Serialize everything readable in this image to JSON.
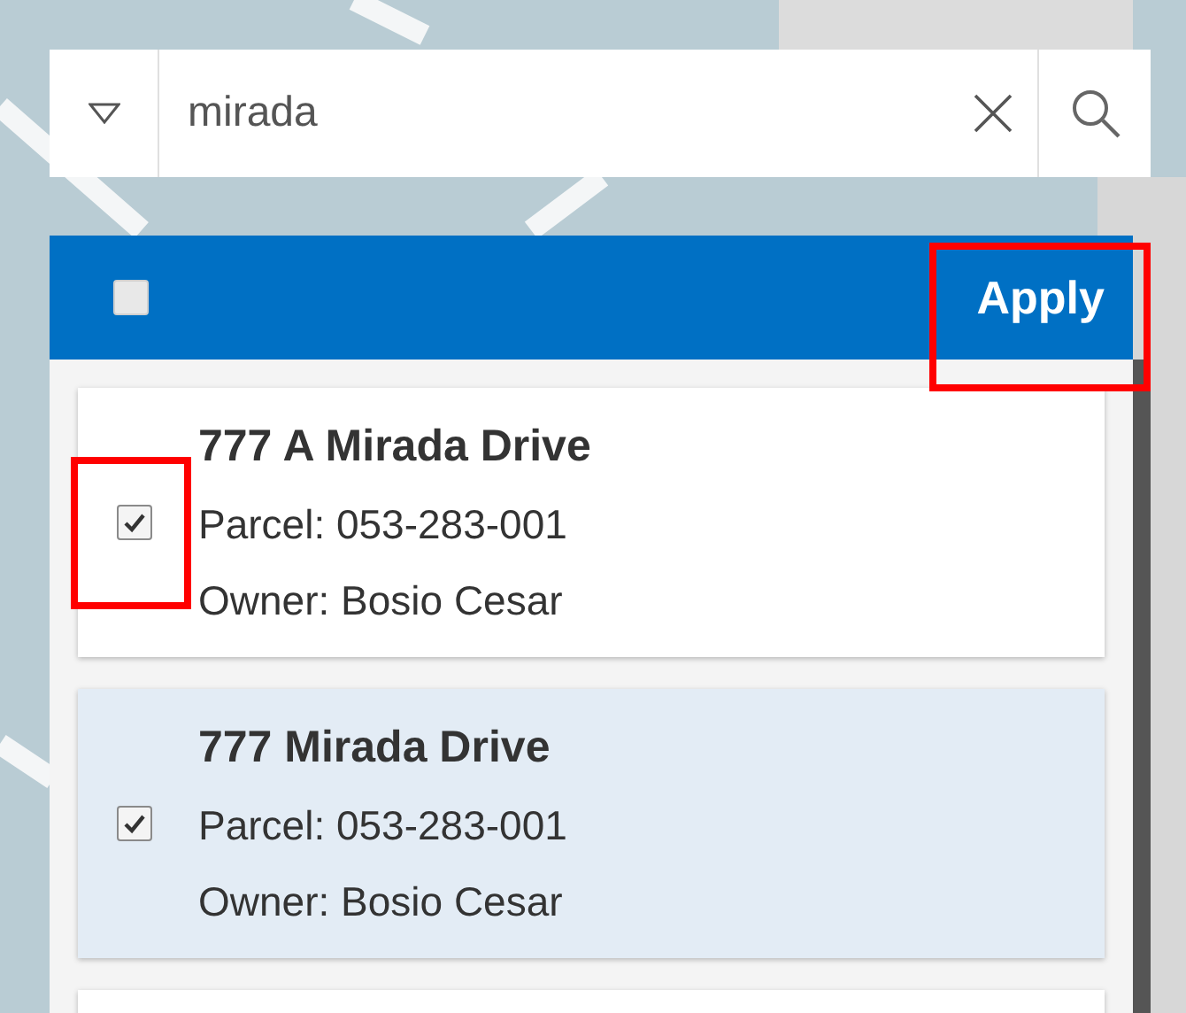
{
  "search": {
    "value": "mirada"
  },
  "header": {
    "select_all_checked": false,
    "apply_button": {
      "label": "Apply",
      "highlighted": true
    }
  },
  "results": [
    {
      "address": "777 A Mirada Drive",
      "parcel": "Parcel: 053-283-001",
      "owner": "Owner: Bosio Cesar",
      "checked": true,
      "selected": false,
      "checkbox_highlighted": true
    },
    {
      "address": "777 Mirada Drive",
      "parcel": "Parcel: 053-283-001",
      "owner": "Owner: Bosio Cesar",
      "checked": true,
      "selected": true,
      "checkbox_highlighted": false
    },
    {
      "selected": false
    }
  ]
}
